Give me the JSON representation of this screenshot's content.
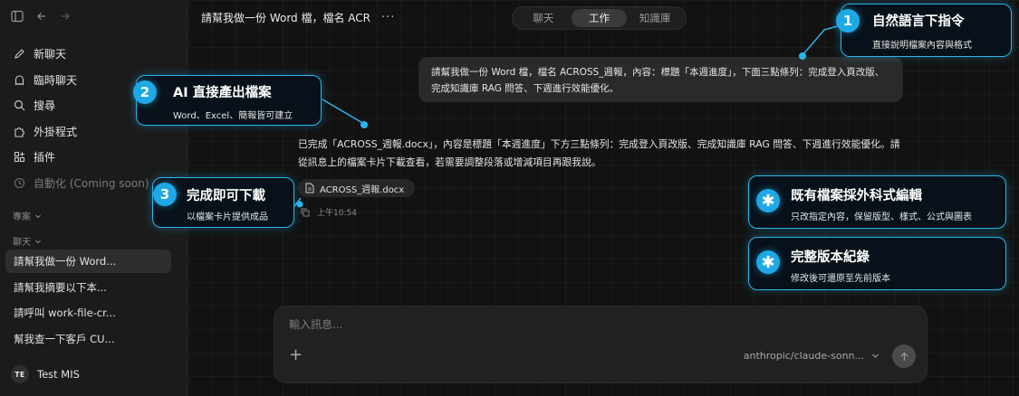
{
  "sidebar": {
    "nav": [
      {
        "label": "新聊天",
        "icon": "edit-icon"
      },
      {
        "label": "臨時聊天",
        "icon": "ghost-icon"
      },
      {
        "label": "搜尋",
        "icon": "search-icon"
      },
      {
        "label": "外掛程式",
        "icon": "puzzle-icon"
      },
      {
        "label": "插件",
        "icon": "grid-plus-icon"
      },
      {
        "label": "自動化 (Coming soon)",
        "icon": "clock-icon"
      }
    ],
    "projects_label": "專案",
    "chats_label": "聊天",
    "chats": [
      "請幫我做一份 Word...",
      "請幫我摘要以下本...",
      "請呼叫 work-file-cr...",
      "幫我查一下客戶 CU..."
    ],
    "user": {
      "initials": "TE",
      "name": "Test MIS"
    }
  },
  "header": {
    "chat_title": "請幫我做一份 Word 檔，檔名 ACR",
    "more": "···",
    "tabs": [
      "聊天",
      "工作",
      "知識庫"
    ],
    "active_tab": "工作"
  },
  "conversation": {
    "user_message": "請幫我做一份 Word 檔，檔名 ACROSS_週報，內容：標題「本週進度」，下面三點條列：完成登入頁改版、完成知識庫 RAG 問答、下週進行效能優化。",
    "ai_message": "已完成「ACROSS_週報.docx」，內容是標題「本週進度」下方三點條列：完成登入頁改版、完成知識庫 RAG 問答、下週進行效能優化。請從訊息上的檔案卡片下載查看，若需要調整段落或增減項目再跟我說。",
    "file_name": "ACROSS_週報.docx",
    "timestamp": "上午10:54"
  },
  "composer": {
    "placeholder": "輸入訊息...",
    "plus": "+",
    "model": "anthropic/claude-sonn..."
  },
  "callouts": [
    {
      "badge": "1",
      "title": "自然語言下指令",
      "subtitle": "直接說明檔案內容與格式"
    },
    {
      "badge": "2",
      "title": "AI 直接產出檔案",
      "subtitle": "Word、Excel、簡報皆可建立"
    },
    {
      "badge": "3",
      "title": "完成即可下載",
      "subtitle": "以檔案卡片提供成品"
    },
    {
      "badge": "✱",
      "title": "既有檔案採外科式編輯",
      "subtitle": "只改指定內容，保留版型、樣式、公式與圖表"
    },
    {
      "badge": "✱",
      "title": "完整版本紀錄",
      "subtitle": "修改後可還原至先前版本"
    }
  ],
  "colors": {
    "accent": "#29b6ee",
    "badge": "#1ea8e6",
    "background": "#121212",
    "sidebar": "#1b1b1b"
  }
}
